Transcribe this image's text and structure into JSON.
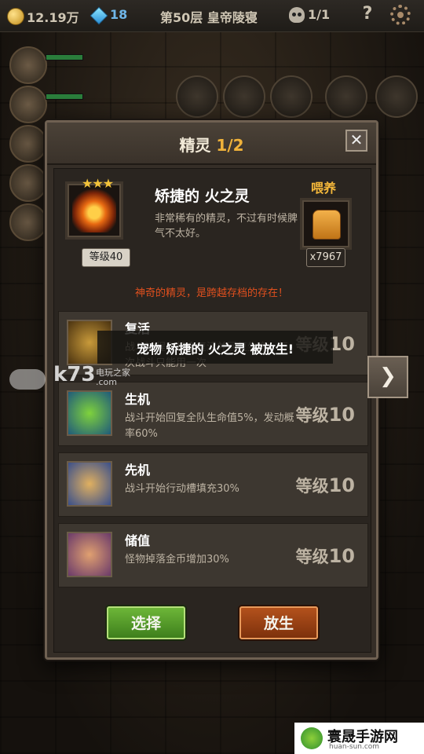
{
  "topbar": {
    "gold": "12.19万",
    "gems": "18",
    "floor": "第50层 皇帝陵寝",
    "skulls": "1/1",
    "help": "?"
  },
  "dialog": {
    "title": "精灵",
    "page": "1/2",
    "close": "✕",
    "spirit": {
      "stars": "★★★",
      "name": "矫捷的 火之灵",
      "description": "非常稀有的精灵，不过有时候脾气不太好。",
      "level": "等级40",
      "tagline": "神奇的精灵，是跨越存档的存在！"
    },
    "feed": {
      "label": "喂养",
      "count": "x7967"
    },
    "skills": [
      {
        "name": "复活",
        "description": "战斗过程有机会复活并回复生命，每次战斗只能用一次",
        "level_label": "等级",
        "level": "10"
      },
      {
        "name": "生机",
        "description": "战斗开始回复全队生命值5%，发动概率60%",
        "level_label": "等级",
        "level": "10"
      },
      {
        "name": "先机",
        "description": "战斗开始行动槽填充30%",
        "level_label": "等级",
        "level": "10"
      },
      {
        "name": "储值",
        "description": "怪物掉落金币增加30%",
        "level_label": "等级",
        "level": "10"
      }
    ],
    "buttons": {
      "select": "选择",
      "release": "放生"
    }
  },
  "next_arrow": "❯",
  "toast": "宠物 矫捷的 火之灵 被放生!",
  "watermarks": {
    "k73": "k73",
    "k73_sub": "电玩之家",
    "k73_com": ".com",
    "site_title": "寰晟手游网",
    "site_url": "huan-sun.com"
  },
  "colors": {
    "accent_gold": "#f0b23a",
    "tagline_red": "#e0501e",
    "select_green": "#4e9a25",
    "release_orange": "#a4461a"
  }
}
